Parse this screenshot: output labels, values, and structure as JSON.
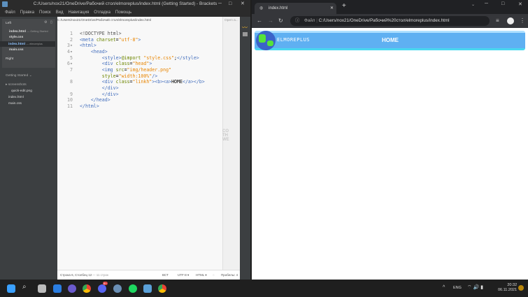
{
  "brackets": {
    "title": "C:/Users/nox21/OneDrive/Рабочий стол/elmoreplus/index.html (Getting Started) - Brackets",
    "menu": [
      "Файл",
      "Правка",
      "Поиск",
      "Вид",
      "Навигация",
      "Отладка",
      "Помощь"
    ],
    "left_label": "Left",
    "right_label": "Right",
    "working_files": [
      {
        "name": "index.html",
        "meta": "— Getting Started"
      },
      {
        "name": "style.css",
        "meta": ""
      },
      {
        "name": "index.html",
        "meta": "— elmoreplus"
      },
      {
        "name": "main.css",
        "meta": ""
      }
    ],
    "project": "Getting Started ⌄",
    "tree": [
      "▸ screenshots",
      "quick-edit.png",
      "index.html",
      "main.css"
    ],
    "path": "C:/Users/nox21/OneDrive/Рабочий стол/elmoreplus/index.html",
    "open_recent": "Open a...",
    "status": {
      "position": "Строка 6, Столбец 12",
      "lines": "— 11 строк",
      "ins": "ВСТ",
      "encoding": "UTF-8 ▾",
      "lang": "HTML ▾",
      "spaces": "Пробелы: 4"
    },
    "watermark": [
      "CO",
      "TH",
      "WE"
    ]
  },
  "browser": {
    "tab_title": "index.html",
    "file_label": "Файл",
    "url": "C:/Users/nox21/OneDrive/Рабочий%20стол/elmoreplus/index.html",
    "logo": "ELMOREPLUS",
    "home": "HOME"
  },
  "tray": {
    "lang": "ENG",
    "time": "20:32",
    "date": "06.11.2021",
    "discord_badge": "9+"
  }
}
